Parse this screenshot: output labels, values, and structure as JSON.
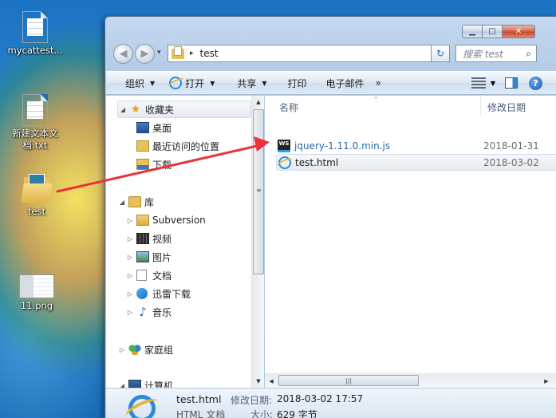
{
  "desktop": {
    "icons": [
      {
        "label": "mycattest..."
      },
      {
        "label": "新建文本文档.txt"
      },
      {
        "label": "test"
      },
      {
        "label": "11.png"
      }
    ]
  },
  "window": {
    "caption": {
      "minimize": "▁",
      "maximize": "□",
      "close": "✕"
    },
    "nav": {
      "back": "◀",
      "forward": "▶",
      "recent": "▾"
    },
    "address": {
      "separator": "▸",
      "path": "test",
      "dropdown": "▾",
      "refresh": "↻"
    },
    "search": {
      "placeholder": "搜索 test",
      "icon": "⌕"
    },
    "toolbar": {
      "organize": "组织",
      "open": "打开",
      "share": "共享",
      "print": "打印",
      "email": "电子邮件",
      "more": "»"
    },
    "nav_pane": {
      "favorites": {
        "label": "收藏夹",
        "items": [
          "桌面",
          "最近访问的位置",
          "下载"
        ]
      },
      "libraries": {
        "label": "库",
        "items": [
          "Subversion",
          "视频",
          "图片",
          "文档",
          "迅雷下载",
          "音乐"
        ]
      },
      "homegroup": {
        "label": "家庭组"
      },
      "computer": {
        "label": "计算机"
      },
      "expanded": "◢",
      "collapsed": "▷"
    },
    "columns": {
      "name": "名称",
      "date": "修改日期",
      "sort": "^"
    },
    "files": [
      {
        "name": "jquery-1.11.0.min.js",
        "date": "2018-01-31",
        "icon": "webstorm-icon",
        "icon_text": "WS"
      },
      {
        "name": "test.html",
        "date": "2018-03-02",
        "icon": "html-ie-icon"
      }
    ],
    "details": {
      "name": "test.html",
      "type": "HTML 文档",
      "modified_label": "修改日期:",
      "modified_value": "2018-03-02 17:57",
      "size_label": "大小:",
      "size_value": "629 字节"
    },
    "scroll": {
      "up": "▲",
      "down": "▼",
      "left": "◀",
      "right": "▶",
      "grip": "|||",
      "vgrip": "≡"
    }
  },
  "colors": {
    "arrow": "#e8333b",
    "accent": "#2e8ad8"
  }
}
